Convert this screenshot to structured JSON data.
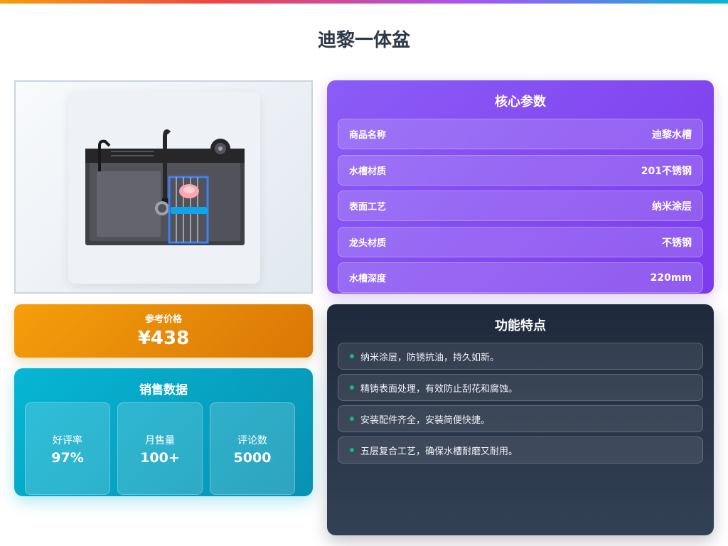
{
  "page": {
    "title": "迪黎一体盆"
  },
  "product_image": {
    "alt": "kitchen-sink-photo"
  },
  "params": {
    "title": "核心参数",
    "rows": [
      {
        "label": "商品名称",
        "value": "迪黎水槽"
      },
      {
        "label": "水槽材质",
        "value": "201不锈钢"
      },
      {
        "label": "表面工艺",
        "value": "纳米涂层"
      },
      {
        "label": "龙头材质",
        "value": "不锈钢"
      },
      {
        "label": "水槽深度",
        "value": "220mm"
      }
    ]
  },
  "price": {
    "label": "参考价格",
    "value": "¥438"
  },
  "sales": {
    "title": "销售数据",
    "stats": [
      {
        "label": "好评率",
        "value": "97%"
      },
      {
        "label": "月售量",
        "value": "100+"
      },
      {
        "label": "评论数",
        "value": "5000"
      }
    ]
  },
  "features": {
    "title": "功能特点",
    "items": [
      "纳米涂层，防锈抗油，持久如新。",
      "精铸表面处理，有效防止刮花和腐蚀。",
      "安装配件齐全，安装简便快捷。",
      "五层复合工艺，确保水槽耐磨又耐用。"
    ]
  },
  "colors": {
    "params_bg": "#8b5cf6",
    "price_bg": "#f59e0b",
    "sales_bg": "#06b6d4",
    "features_bg": "#1e293b",
    "feature_dot": "#10b981"
  }
}
